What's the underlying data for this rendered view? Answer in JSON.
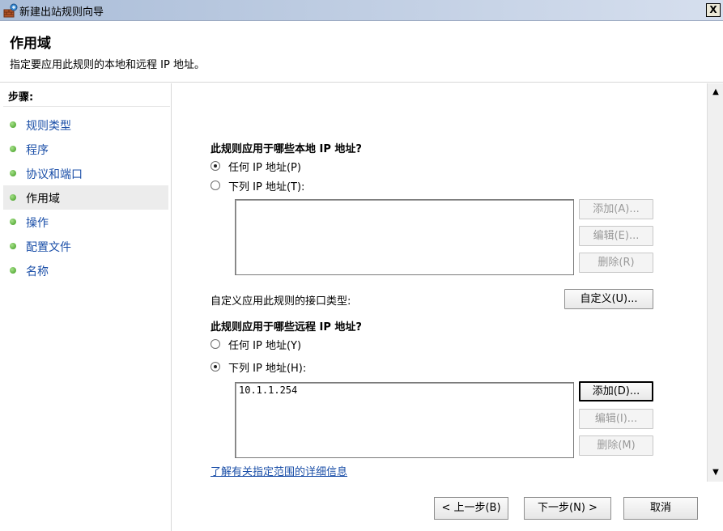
{
  "window": {
    "title": "新建出站规则向导",
    "close_label": "X"
  },
  "header": {
    "title": "作用域",
    "subtitle": "指定要应用此规则的本地和远程 IP 地址。"
  },
  "steps": {
    "label": "步骤:",
    "items": [
      {
        "label": "规则类型"
      },
      {
        "label": "程序"
      },
      {
        "label": "协议和端口"
      },
      {
        "label": "作用域"
      },
      {
        "label": "操作"
      },
      {
        "label": "配置文件"
      },
      {
        "label": "名称"
      }
    ],
    "active_index": 3
  },
  "local": {
    "question": "此规则应用于哪些本地 IP 地址?",
    "option_any": "任何 IP 地址(P)",
    "option_list": "下列 IP 地址(T):",
    "selected": "any",
    "entries": [],
    "add_label": "添加(A)...",
    "edit_label": "编辑(E)...",
    "delete_label": "删除(R)"
  },
  "interface": {
    "label": "自定义应用此规则的接口类型:",
    "button_label": "自定义(U)..."
  },
  "remote": {
    "question": "此规则应用于哪些远程 IP 地址?",
    "option_any": "任何 IP 地址(Y)",
    "option_list": "下列 IP 地址(H):",
    "selected": "list",
    "entries": [
      "10.1.1.254"
    ],
    "add_label": "添加(D)...",
    "edit_label": "编辑(I)...",
    "delete_label": "删除(M)"
  },
  "link": {
    "label": "了解有关指定范围的详细信息"
  },
  "footer": {
    "back_label": "< 上一步(B)",
    "next_label": "下一步(N) >",
    "cancel_label": "取消"
  }
}
